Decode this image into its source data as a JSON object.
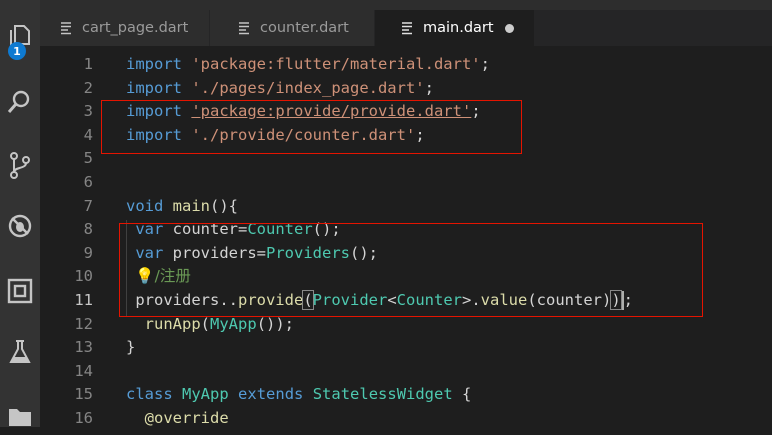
{
  "badge_count": "1",
  "tabs": [
    {
      "label": "cart_page.dart",
      "active": false
    },
    {
      "label": "counter.dart",
      "active": false
    },
    {
      "label": "main.dart",
      "active": true,
      "dirty": true
    }
  ],
  "colors": {
    "activity_bar": "#333333",
    "editor_bg": "#1e1e1e",
    "annotation_box": "#e51400",
    "keyword": "#569cd6",
    "string": "#ce9178",
    "class": "#4ec9b0",
    "function": "#dcdcaa",
    "comment": "#6a9955"
  },
  "activity_icons": [
    "explorer-icon",
    "search-icon",
    "source-control-icon",
    "debug-icon",
    "extensions-icon",
    "test-flask-icon",
    "folder-icon"
  ],
  "lines": [
    {
      "n": "1",
      "tokens": [
        {
          "t": "import",
          "c": "kw"
        },
        {
          "t": " "
        },
        {
          "t": "'package:flutter/material.dart'",
          "c": "str"
        },
        {
          "t": ";"
        }
      ]
    },
    {
      "n": "2",
      "tokens": [
        {
          "t": "import",
          "c": "kw"
        },
        {
          "t": " "
        },
        {
          "t": "'./pages/index_page.dart'",
          "c": "str"
        },
        {
          "t": ";"
        }
      ]
    },
    {
      "n": "3",
      "tokens": [
        {
          "t": "import",
          "c": "kw"
        },
        {
          "t": " "
        },
        {
          "t": "'package:provide/provide.dart'",
          "c": "str-link"
        },
        {
          "t": ";"
        }
      ]
    },
    {
      "n": "4",
      "tokens": [
        {
          "t": "import",
          "c": "kw"
        },
        {
          "t": " "
        },
        {
          "t": "'./provide/counter.dart'",
          "c": "str"
        },
        {
          "t": ";"
        }
      ]
    },
    {
      "n": "5",
      "tokens": []
    },
    {
      "n": "6",
      "tokens": []
    },
    {
      "n": "7",
      "tokens": [
        {
          "t": "void",
          "c": "kw"
        },
        {
          "t": " "
        },
        {
          "t": "main",
          "c": "fn"
        },
        {
          "t": "(){"
        }
      ]
    },
    {
      "n": "8",
      "tokens": [
        {
          "t": " "
        },
        {
          "t": "var",
          "c": "kw"
        },
        {
          "t": " counter="
        },
        {
          "t": "Counter",
          "c": "cls"
        },
        {
          "t": "();"
        }
      ]
    },
    {
      "n": "9",
      "tokens": [
        {
          "t": " "
        },
        {
          "t": "var",
          "c": "kw"
        },
        {
          "t": " providers="
        },
        {
          "t": "Providers",
          "c": "cls"
        },
        {
          "t": "();"
        }
      ]
    },
    {
      "n": "10",
      "tokens": [
        {
          "t": " "
        },
        {
          "t": "💡",
          "c": "bulb"
        },
        {
          "t": "/注册",
          "c": "cmt"
        }
      ]
    },
    {
      "n": "11",
      "current": true,
      "tokens": [
        {
          "t": " providers.."
        },
        {
          "t": "provide",
          "c": "fn"
        },
        {
          "t": "(",
          "c": "bracket-hl"
        },
        {
          "t": "Provider",
          "c": "cls"
        },
        {
          "t": "<"
        },
        {
          "t": "Counter",
          "c": "cls"
        },
        {
          "t": ">."
        },
        {
          "t": "value",
          "c": "fn"
        },
        {
          "t": "(counter)"
        },
        {
          "t": ")",
          "c": "bracket-hl"
        },
        {
          "t": "",
          "c": "caret"
        },
        {
          "t": ";"
        }
      ]
    },
    {
      "n": "12",
      "tokens": [
        {
          "t": "  "
        },
        {
          "t": "runApp",
          "c": "fn"
        },
        {
          "t": "("
        },
        {
          "t": "MyApp",
          "c": "cls"
        },
        {
          "t": "());"
        }
      ]
    },
    {
      "n": "13",
      "tokens": [
        {
          "t": "}"
        }
      ]
    },
    {
      "n": "14",
      "tokens": []
    },
    {
      "n": "15",
      "tokens": [
        {
          "t": "class",
          "c": "kw"
        },
        {
          "t": " "
        },
        {
          "t": "MyApp",
          "c": "cls"
        },
        {
          "t": " "
        },
        {
          "t": "extends",
          "c": "kw"
        },
        {
          "t": " "
        },
        {
          "t": "StatelessWidget",
          "c": "cls"
        },
        {
          "t": " {"
        }
      ]
    },
    {
      "n": "16",
      "tokens": [
        {
          "t": "  "
        },
        {
          "t": "@override",
          "c": "fn"
        }
      ]
    }
  ]
}
